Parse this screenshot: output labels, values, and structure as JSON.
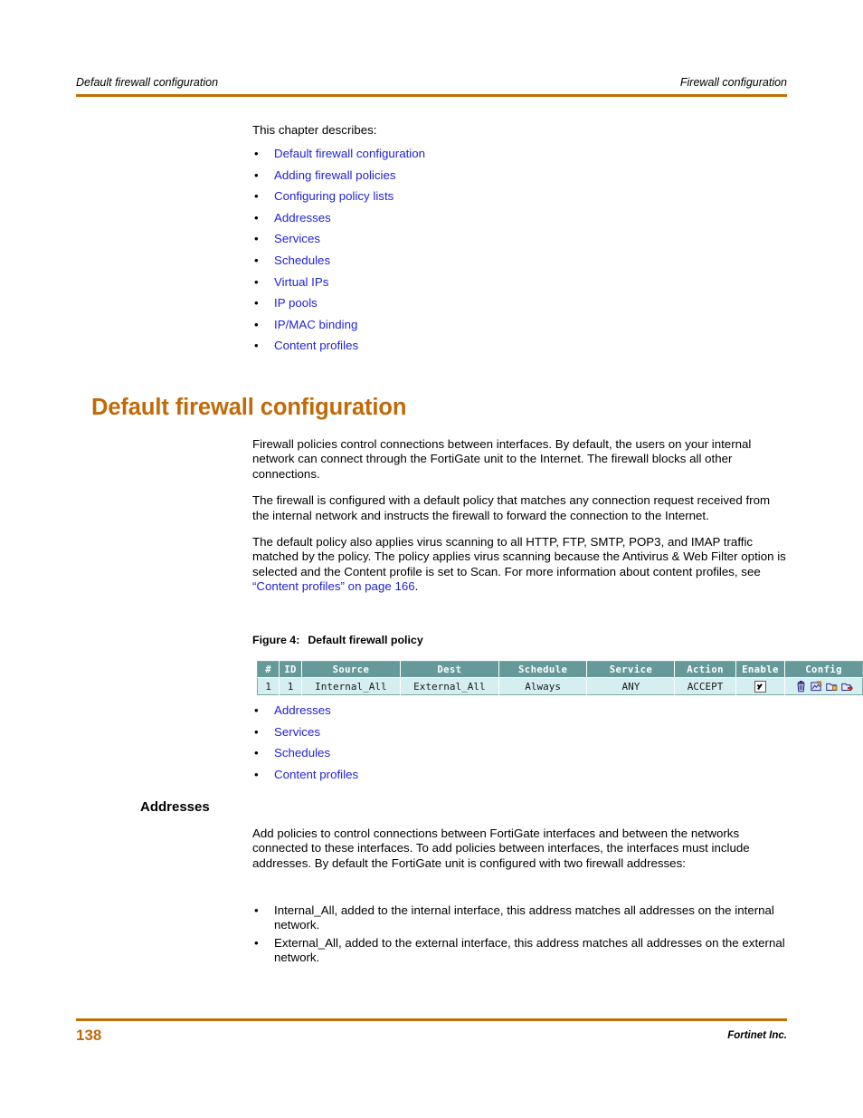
{
  "running_header": {
    "left": "Default firewall configuration",
    "right": "Firewall configuration"
  },
  "intro": {
    "text": "This chapter describes:"
  },
  "chapter_toc": {
    "bullet": "•",
    "items": [
      {
        "label": "Default firewall configuration"
      },
      {
        "label": "Adding firewall policies"
      },
      {
        "label": "Configuring policy lists"
      },
      {
        "label": "Addresses"
      },
      {
        "label": "Services"
      },
      {
        "label": "Schedules"
      },
      {
        "label": "Virtual IPs"
      },
      {
        "label": "IP pools"
      },
      {
        "label": "IP/MAC binding"
      },
      {
        "label": "Content profiles"
      }
    ]
  },
  "chapter_heading": "Default firewall configuration",
  "paragraphs": {
    "p1": "Firewall policies control connections between interfaces. By default, the users on your internal network can connect through the FortiGate unit to the Internet. The firewall blocks all other connections.",
    "p2": "The firewall is configured with a default policy that matches any connection request received from the internal network and instructs the firewall to forward the connection to the Internet.",
    "p3_before": "The default policy also applies virus scanning to all HTTP, FTP, SMTP, POP3, and IMAP traffic matched by the policy. The policy applies virus scanning because the Antivirus & Web Filter option is selected and the Content profile is set to Scan. For more information about content profiles, see ",
    "p3_link": "“Content profiles” on page 166",
    "p3_after": "."
  },
  "figure": {
    "number": "Figure 4:",
    "title": "Default firewall policy",
    "table": {
      "headers": [
        "#",
        "ID",
        "Source",
        "Dest",
        "Schedule",
        "Service",
        "Action",
        "Enable",
        "Config"
      ],
      "rows": [
        {
          "num": "1",
          "id": "1",
          "source": "Internal_All",
          "dest": "External_All",
          "schedule": "Always",
          "service": "ANY",
          "action": "ACCEPT",
          "enable": true,
          "config_icons": [
            "delete-icon",
            "edit-icon",
            "insert-policy-icon",
            "move-policy-icon"
          ]
        }
      ],
      "header_bg": "#669a9a",
      "row_bg": "#d5eef0"
    }
  },
  "figure_toc": {
    "bullet": "•",
    "items": [
      {
        "label": "Addresses"
      },
      {
        "label": "Services"
      },
      {
        "label": "Schedules"
      },
      {
        "label": "Content profiles"
      }
    ]
  },
  "addresses_section": {
    "heading": "Addresses",
    "body": "Add policies to control connections between FortiGate interfaces and between the networks connected to these interfaces. To add policies between interfaces, the interfaces must include addresses. By default the FortiGate unit is configured with two firewall addresses:",
    "bullet": "•",
    "items": [
      {
        "label": "Internal_All, added to the internal interface, this address matches all addresses on the internal network."
      },
      {
        "label": "External_All, added to the external interface, this address matches all addresses on the external network."
      }
    ]
  },
  "footer": {
    "page_number": "138",
    "company": "Fortinet Inc."
  },
  "colors": {
    "rule": "#c07000",
    "heading": "#c06a0a",
    "link": "#2222dd",
    "table_header": "#669a9a",
    "table_row": "#d5eef0"
  }
}
